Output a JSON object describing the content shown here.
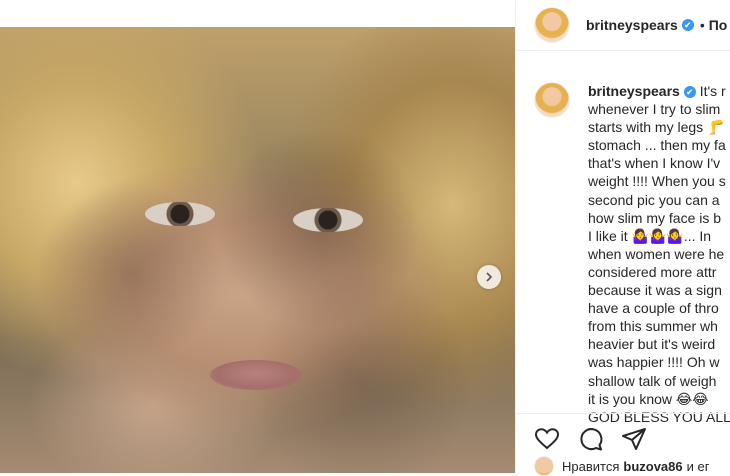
{
  "header": {
    "username": "britneyspears",
    "verified_mark": "✔",
    "separator": "•",
    "follow_label": "По"
  },
  "caption": {
    "username": "britneyspears",
    "lines": [
      " It's r",
      "whenever I try to slim",
      "starts with my legs 🦵",
      "stomach ... then my fa",
      "that's when I know I'v",
      "weight !!!! When you s",
      "second pic you can a",
      "how slim my face is b",
      "I like it 🤷‍♀️🤷‍♀️🤷‍♀️... In",
      "when women were he",
      "considered more attr",
      "because it was a sign",
      "have a couple of thro",
      "from this summer wh",
      "heavier but it's weird",
      "was happier !!!! Oh w",
      "shallow talk of weigh",
      "it is you know 😂😂",
      "GOD BLESS YOU ALL"
    ]
  },
  "likes": {
    "prefix": "Нравится",
    "user": "buzova86",
    "suffix": "и ег"
  },
  "icons": {
    "like": "heart-icon",
    "comment": "comment-icon",
    "share": "share-icon",
    "next": "chevron-right-icon"
  },
  "colors": {
    "verified": "#3897f0",
    "text": "#262626",
    "border": "#efefef"
  }
}
